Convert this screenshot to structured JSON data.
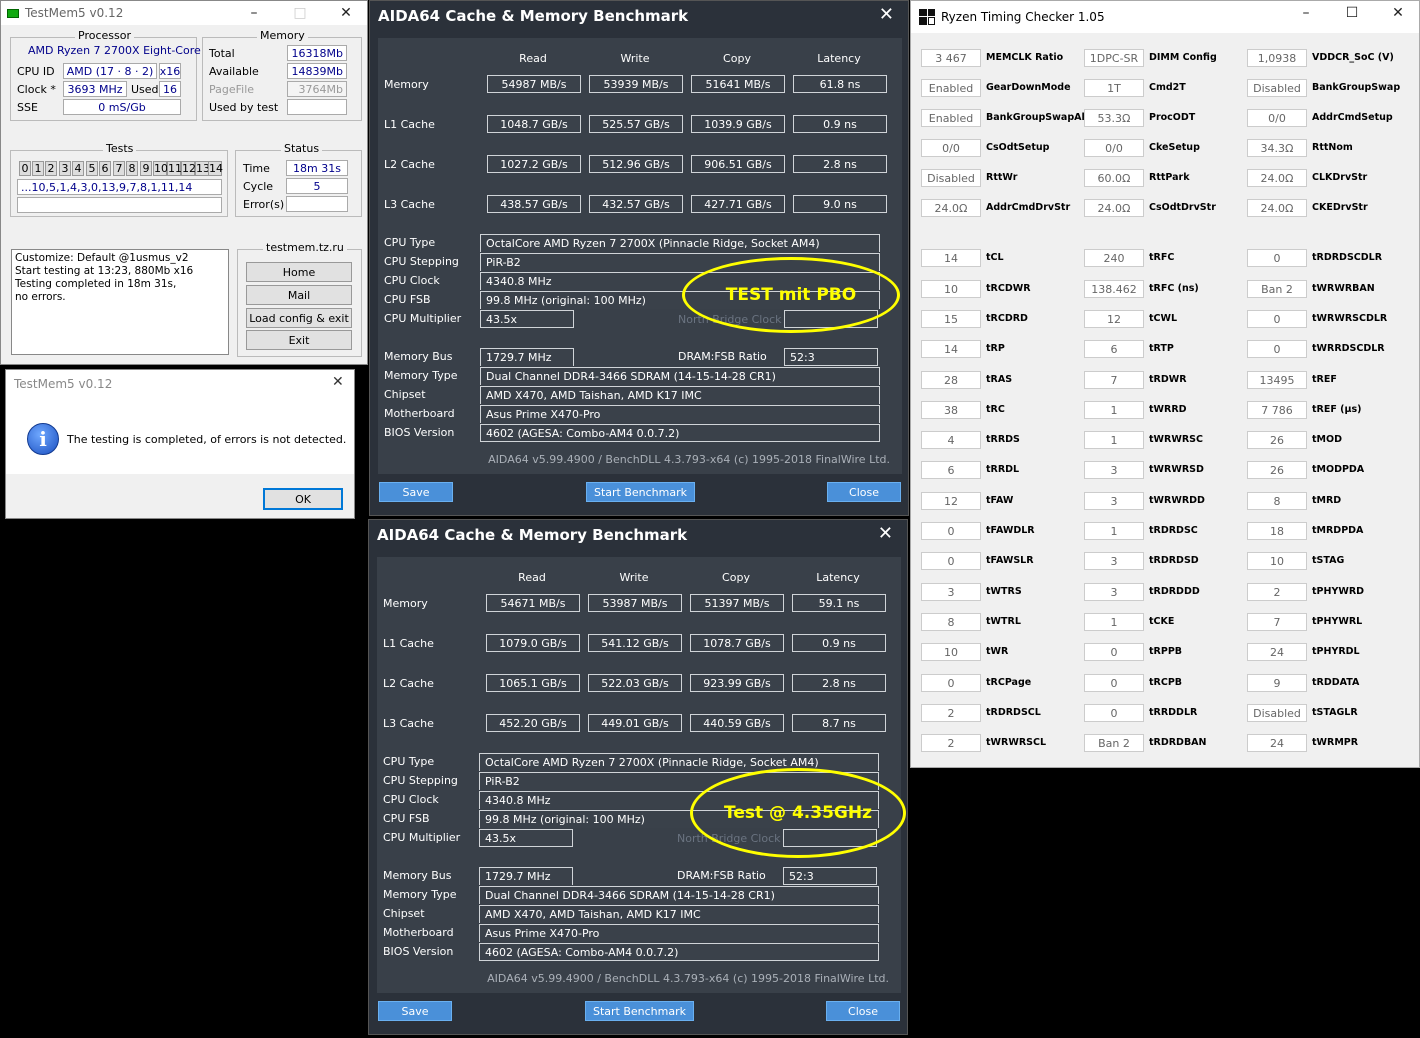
{
  "testmem": {
    "title": "TestMem5 v0.12",
    "processor": {
      "title": "Processor",
      "name": "AMD Ryzen 7 2700X Eight-Core",
      "cpuid_label": "CPU ID",
      "cpuid": "AMD  (17 · 8 · 2)",
      "threads": "x16",
      "clock_label": "Clock *",
      "clock": "3693 MHz",
      "used_label": "Used",
      "used": "16",
      "sse_label": "SSE",
      "sse": "0 mS/Gb"
    },
    "memory": {
      "title": "Memory",
      "total_label": "Total",
      "total": "16318Mb",
      "avail_label": "Available",
      "avail": "14839Mb",
      "pagefile_label": "PageFile",
      "pagefile": "3764Mb",
      "usedby_label": "Used by test",
      "usedby": ""
    },
    "tests": {
      "title": "Tests",
      "cells": [
        "0",
        "1",
        "2",
        "3",
        "4",
        "5",
        "6",
        "7",
        "8",
        "9",
        "10",
        "11",
        "12",
        "13",
        "14"
      ],
      "sequence": "...10,5,1,4,3,0,13,9,7,8,1,11,14"
    },
    "status": {
      "title": "Status",
      "time_label": "Time",
      "time": "18m 31s",
      "cycle_label": "Cycle",
      "cycle": "5",
      "errors_label": "Error(s)",
      "errors": ""
    },
    "log": [
      "Customize: Default @1usmus_v2",
      "Start testing at 13:23, 880Mb x16",
      "Testing completed in 18m 31s,",
      "no errors."
    ],
    "site": "testmem.tz.ru",
    "buttons": {
      "home": "Home",
      "mail": "Mail",
      "load": "Load config & exit",
      "exit": "Exit"
    }
  },
  "dialog": {
    "title": "TestMem5 v0.12",
    "message": "The testing is completed, of errors is not detected.",
    "ok": "OK"
  },
  "aida": [
    {
      "title": "AIDA64 Cache & Memory Benchmark",
      "headers": [
        "Read",
        "Write",
        "Copy",
        "Latency"
      ],
      "rows": [
        {
          "label": "Memory",
          "values": [
            "54987 MB/s",
            "53939 MB/s",
            "51641 MB/s",
            "61.8 ns"
          ]
        },
        {
          "label": "L1 Cache",
          "values": [
            "1048.7 GB/s",
            "525.57 GB/s",
            "1039.9 GB/s",
            "0.9 ns"
          ]
        },
        {
          "label": "L2 Cache",
          "values": [
            "1027.2 GB/s",
            "512.96 GB/s",
            "906.51 GB/s",
            "2.8 ns"
          ]
        },
        {
          "label": "L3 Cache",
          "values": [
            "438.57 GB/s",
            "432.57 GB/s",
            "427.71 GB/s",
            "9.0 ns"
          ]
        }
      ],
      "cpu_type_l": "CPU Type",
      "cpu_type": "OctalCore AMD Ryzen 7 2700X  (Pinnacle Ridge, Socket AM4)",
      "cpu_step_l": "CPU Stepping",
      "cpu_step": "PiR-B2",
      "cpu_clock_l": "CPU Clock",
      "cpu_clock": "4340.8 MHz",
      "cpu_fsb_l": "CPU FSB",
      "cpu_fsb": "99.8 MHz  (original: 100 MHz)",
      "cpu_mult_l": "CPU Multiplier",
      "cpu_mult": "43.5x",
      "nb_l": "North Bridge Clock",
      "membus_l": "Memory Bus",
      "membus": "1729.7 MHz",
      "ratio_l": "DRAM:FSB Ratio",
      "ratio": "52:3",
      "memtype_l": "Memory Type",
      "memtype": "Dual Channel DDR4-3466 SDRAM  (14-15-14-28 CR1)",
      "chipset_l": "Chipset",
      "chipset": "AMD X470, AMD Taishan, AMD K17 IMC",
      "mobo_l": "Motherboard",
      "mobo": "Asus Prime X470-Pro",
      "bios_l": "BIOS Version",
      "bios": "4602  (AGESA: Combo-AM4 0.0.7.2)",
      "footer": "AIDA64 v5.99.4900 / BenchDLL 4.3.793-x64  (c) 1995-2018 FinalWire Ltd.",
      "btn_save": "Save",
      "btn_start": "Start Benchmark",
      "btn_close": "Close",
      "annotation": "TEST mit PBO"
    },
    {
      "title": "AIDA64 Cache & Memory Benchmark",
      "headers": [
        "Read",
        "Write",
        "Copy",
        "Latency"
      ],
      "rows": [
        {
          "label": "Memory",
          "values": [
            "54671 MB/s",
            "53987 MB/s",
            "51397 MB/s",
            "59.1 ns"
          ]
        },
        {
          "label": "L1 Cache",
          "values": [
            "1079.0 GB/s",
            "541.12 GB/s",
            "1078.7 GB/s",
            "0.9 ns"
          ]
        },
        {
          "label": "L2 Cache",
          "values": [
            "1065.1 GB/s",
            "522.03 GB/s",
            "923.99 GB/s",
            "2.8 ns"
          ]
        },
        {
          "label": "L3 Cache",
          "values": [
            "452.20 GB/s",
            "449.01 GB/s",
            "440.59 GB/s",
            "8.7 ns"
          ]
        }
      ],
      "cpu_type_l": "CPU Type",
      "cpu_type": "OctalCore AMD Ryzen 7 2700X  (Pinnacle Ridge, Socket AM4)",
      "cpu_step_l": "CPU Stepping",
      "cpu_step": "PiR-B2",
      "cpu_clock_l": "CPU Clock",
      "cpu_clock": "4340.8 MHz",
      "cpu_fsb_l": "CPU FSB",
      "cpu_fsb": "99.8 MHz  (original: 100 MHz)",
      "cpu_mult_l": "CPU Multiplier",
      "cpu_mult": "43.5x",
      "nb_l": "North Bridge Clock",
      "membus_l": "Memory Bus",
      "membus": "1729.7 MHz",
      "ratio_l": "DRAM:FSB Ratio",
      "ratio": "52:3",
      "memtype_l": "Memory Type",
      "memtype": "Dual Channel DDR4-3466 SDRAM  (14-15-14-28 CR1)",
      "chipset_l": "Chipset",
      "chipset": "AMD X470, AMD Taishan, AMD K17 IMC",
      "mobo_l": "Motherboard",
      "mobo": "Asus Prime X470-Pro",
      "bios_l": "BIOS Version",
      "bios": "4602  (AGESA: Combo-AM4 0.0.7.2)",
      "footer": "AIDA64 v5.99.4900 / BenchDLL 4.3.793-x64  (c) 1995-2018 FinalWire Ltd.",
      "btn_save": "Save",
      "btn_start": "Start Benchmark",
      "btn_close": "Close",
      "annotation": "Test @ 4.35GHz"
    }
  ],
  "rtc": {
    "title": "Ryzen Timing Checker 1.05",
    "col1": [
      [
        "3 467",
        "MEMCLK Ratio"
      ],
      [
        "Enabled",
        "GearDownMode"
      ],
      [
        "Enabled",
        "BankGroupSwapAlt"
      ],
      [
        "0/0",
        "CsOdtSetup"
      ],
      [
        "Disabled",
        "RttWr"
      ],
      [
        "24.0Ω",
        "AddrCmdDrvStr"
      ],
      [
        "14",
        "tCL"
      ],
      [
        "10",
        "tRCDWR"
      ],
      [
        "15",
        "tRCDRD"
      ],
      [
        "14",
        "tRP"
      ],
      [
        "28",
        "tRAS"
      ],
      [
        "38",
        "tRC"
      ],
      [
        "4",
        "tRRDS"
      ],
      [
        "6",
        "tRRDL"
      ],
      [
        "12",
        "tFAW"
      ],
      [
        "0",
        "tFAWDLR"
      ],
      [
        "0",
        "tFAWSLR"
      ],
      [
        "3",
        "tWTRS"
      ],
      [
        "8",
        "tWTRL"
      ],
      [
        "10",
        "tWR"
      ],
      [
        "0",
        "tRCPage"
      ],
      [
        "2",
        "tRDRDSCL"
      ],
      [
        "2",
        "tWRWRSCL"
      ]
    ],
    "col2": [
      [
        "1DPC-SR",
        "DIMM Config"
      ],
      [
        "1T",
        "Cmd2T"
      ],
      [
        "53.3Ω",
        "ProcODT"
      ],
      [
        "0/0",
        "CkeSetup"
      ],
      [
        "60.0Ω",
        "RttPark"
      ],
      [
        "24.0Ω",
        "CsOdtDrvStr"
      ],
      [
        "240",
        "tRFC"
      ],
      [
        "138.462",
        "tRFC (ns)"
      ],
      [
        "12",
        "tCWL"
      ],
      [
        "6",
        "tRTP"
      ],
      [
        "7",
        "tRDWR"
      ],
      [
        "1",
        "tWRRD"
      ],
      [
        "1",
        "tWRWRSC"
      ],
      [
        "3",
        "tWRWRSD"
      ],
      [
        "3",
        "tWRWRDD"
      ],
      [
        "1",
        "tRDRDSC"
      ],
      [
        "3",
        "tRDRDSD"
      ],
      [
        "3",
        "tRDRDDD"
      ],
      [
        "1",
        "tCKE"
      ],
      [
        "0",
        "tRPPB"
      ],
      [
        "0",
        "tRCPB"
      ],
      [
        "0",
        "tRRDDLR"
      ],
      [
        "Ban 2",
        "tRDRDBAN"
      ]
    ],
    "col3": [
      [
        "1,0938",
        "VDDCR_SoC (V)"
      ],
      [
        "Disabled",
        "BankGroupSwap"
      ],
      [
        "0/0",
        "AddrCmdSetup"
      ],
      [
        "34.3Ω",
        "RttNom"
      ],
      [
        "24.0Ω",
        "CLKDrvStr"
      ],
      [
        "24.0Ω",
        "CKEDrvStr"
      ],
      [
        "0",
        "tRDRDSCDLR"
      ],
      [
        "Ban 2",
        "tWRWRBAN"
      ],
      [
        "0",
        "tWRWRSCDLR"
      ],
      [
        "0",
        "tWRRDSCDLR"
      ],
      [
        "13495",
        "tREF"
      ],
      [
        "7 786",
        "tREF (µs)"
      ],
      [
        "26",
        "tMOD"
      ],
      [
        "26",
        "tMODPDA"
      ],
      [
        "8",
        "tMRD"
      ],
      [
        "18",
        "tMRDPDA"
      ],
      [
        "10",
        "tSTAG"
      ],
      [
        "2",
        "tPHYWRD"
      ],
      [
        "7",
        "tPHYWRL"
      ],
      [
        "24",
        "tPHYRDL"
      ],
      [
        "9",
        "tRDDATA"
      ],
      [
        "Disabled",
        "tSTAGLR"
      ],
      [
        "24",
        "tWRMPR"
      ]
    ]
  }
}
